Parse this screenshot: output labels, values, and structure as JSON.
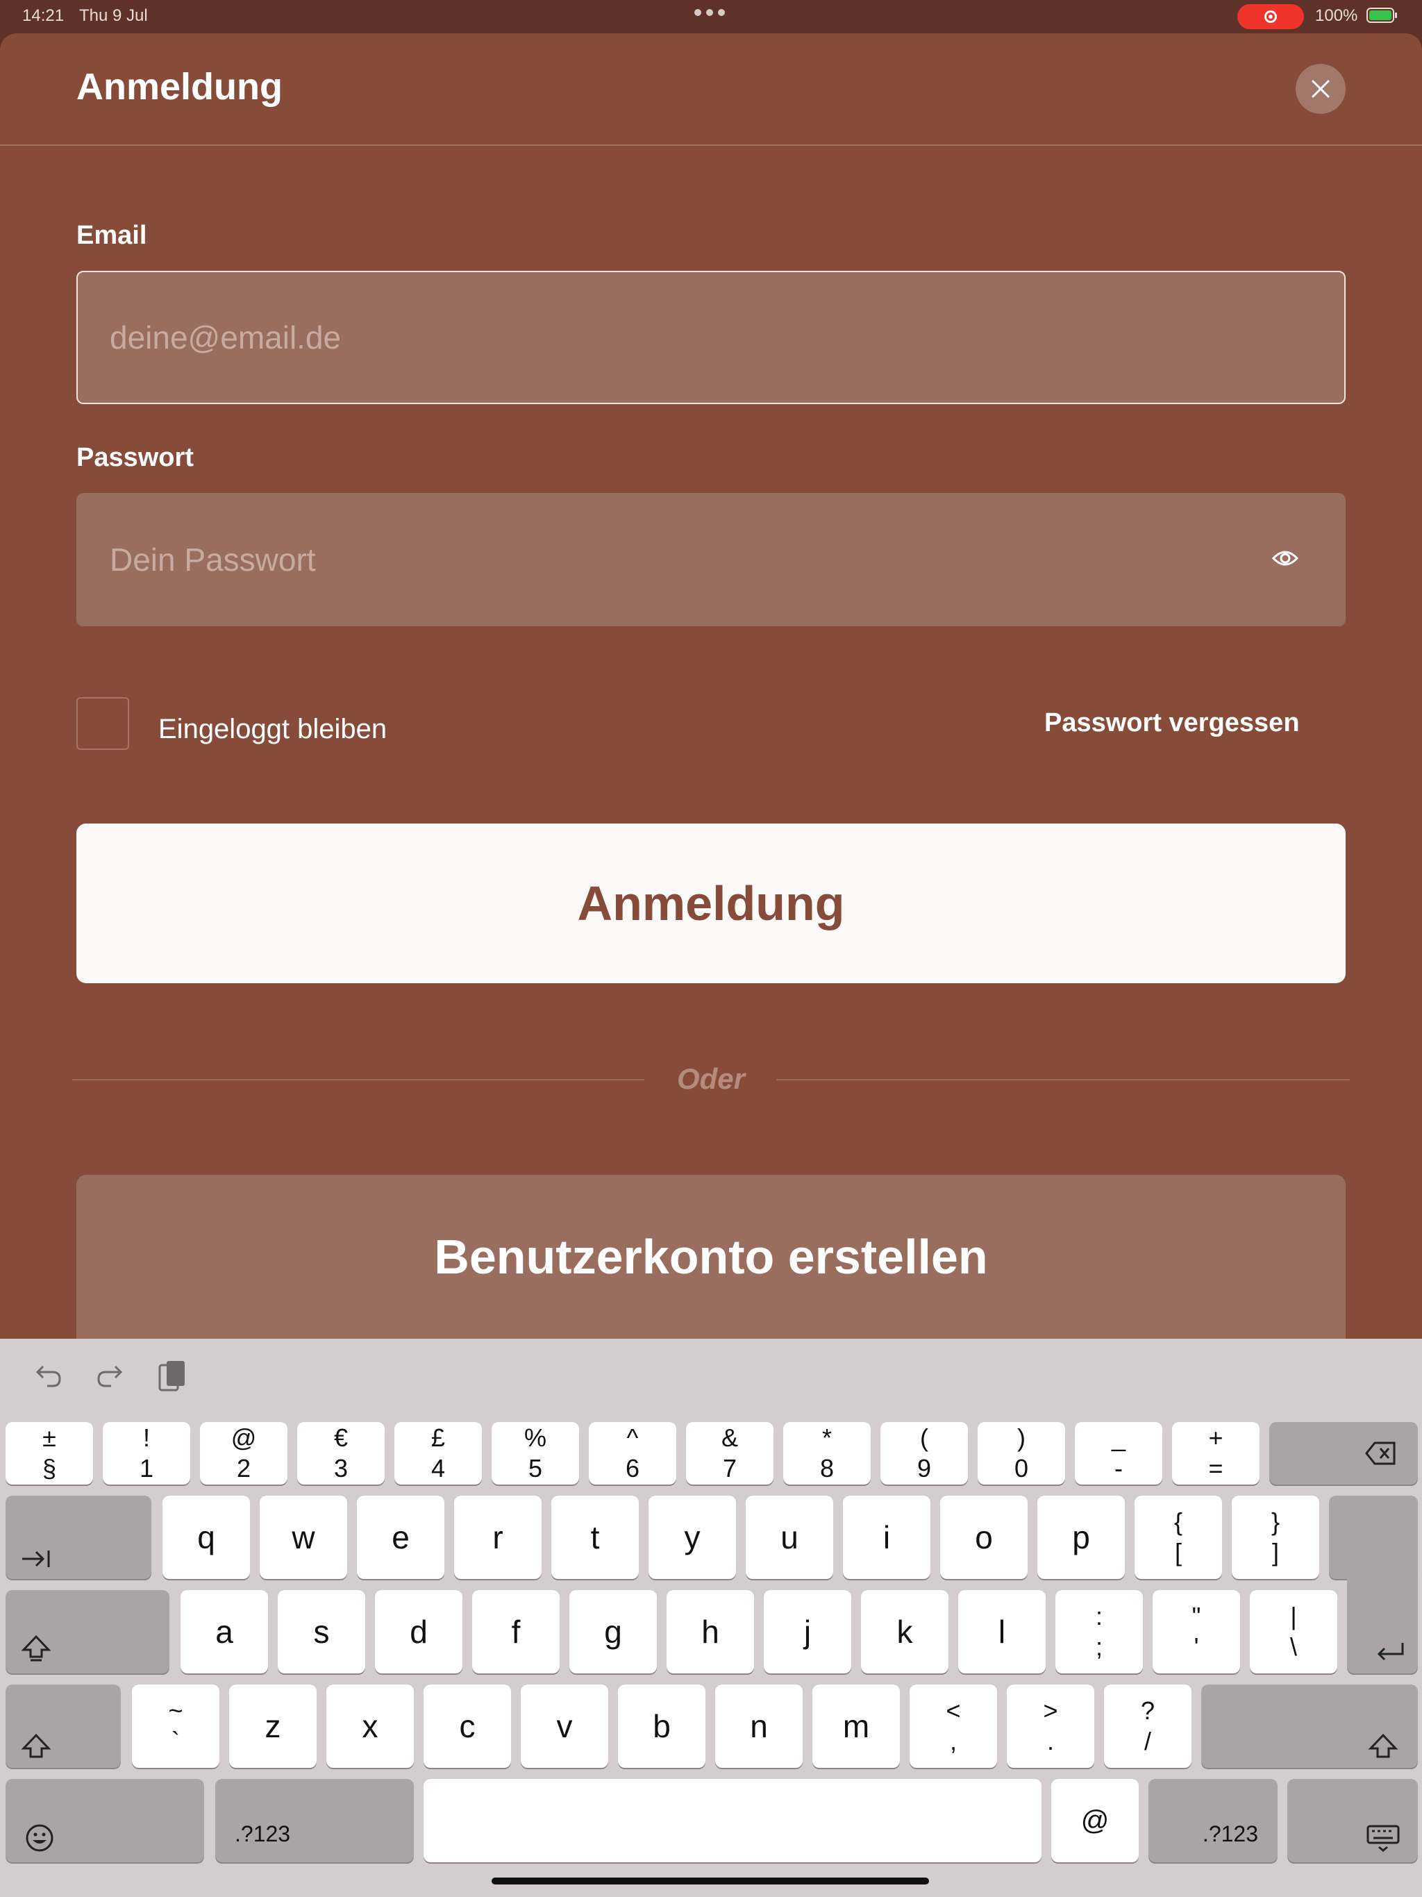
{
  "status_bar": {
    "time": "14:21",
    "date": "Thu 9 Jul",
    "battery": "100%",
    "icons": [
      "more-dots-icon",
      "screen-recording-icon",
      "battery-charging-icon"
    ]
  },
  "sheet": {
    "title": "Anmeldung",
    "close_icon": "close-icon"
  },
  "form": {
    "email_label": "Email",
    "email_placeholder": "deine@email.de",
    "password_label": "Passwort",
    "password_placeholder": "Dein Passwort",
    "show_password_icon": "eye-icon",
    "remember_label": "Eingeloggt bleiben",
    "remember_checked": false,
    "forgot_label": "Passwort vergessen",
    "submit_label": "Anmeldung",
    "or_label": "Oder",
    "register_label": "Benutzerkonto erstellen"
  },
  "keyboard": {
    "toolbar_icons": [
      "undo-icon",
      "redo-icon",
      "paste-icon"
    ],
    "row1": [
      {
        "top": "±",
        "bottom": "§"
      },
      {
        "top": "!",
        "bottom": "1"
      },
      {
        "top": "@",
        "bottom": "2"
      },
      {
        "top": "€",
        "bottom": "3"
      },
      {
        "top": "£",
        "bottom": "4"
      },
      {
        "top": "%",
        "bottom": "5"
      },
      {
        "top": "^",
        "bottom": "6"
      },
      {
        "top": "&",
        "bottom": "7"
      },
      {
        "top": "*",
        "bottom": "8"
      },
      {
        "top": "(",
        "bottom": "9"
      },
      {
        "top": ")",
        "bottom": "0"
      },
      {
        "top": "_",
        "bottom": "-"
      },
      {
        "top": "+",
        "bottom": "="
      }
    ],
    "row2": [
      "q",
      "w",
      "e",
      "r",
      "t",
      "y",
      "u",
      "i",
      "o",
      "p"
    ],
    "row2_extra": [
      {
        "top": "{",
        "bottom": "["
      },
      {
        "top": "}",
        "bottom": "]"
      }
    ],
    "row3": [
      "a",
      "s",
      "d",
      "f",
      "g",
      "h",
      "j",
      "k",
      "l"
    ],
    "row3_extra": [
      {
        "top": ":",
        "bottom": ";"
      },
      {
        "top": "\"",
        "bottom": "'"
      },
      {
        "top": "|",
        "bottom": "\\"
      }
    ],
    "row4_first": {
      "top": "~",
      "bottom": "`"
    },
    "row4": [
      "z",
      "x",
      "c",
      "v",
      "b",
      "n",
      "m"
    ],
    "row4_extra": [
      {
        "top": "<",
        "bottom": ","
      },
      {
        "top": ">",
        "bottom": "."
      },
      {
        "top": "?",
        "bottom": "/"
      }
    ],
    "numbers_label": ".?123",
    "at_label": "@",
    "special_icons": [
      "delete-icon",
      "tab-icon",
      "caps-lock-icon",
      "return-icon",
      "shift-icon",
      "emoji-icon",
      "dismiss-keyboard-icon"
    ]
  }
}
